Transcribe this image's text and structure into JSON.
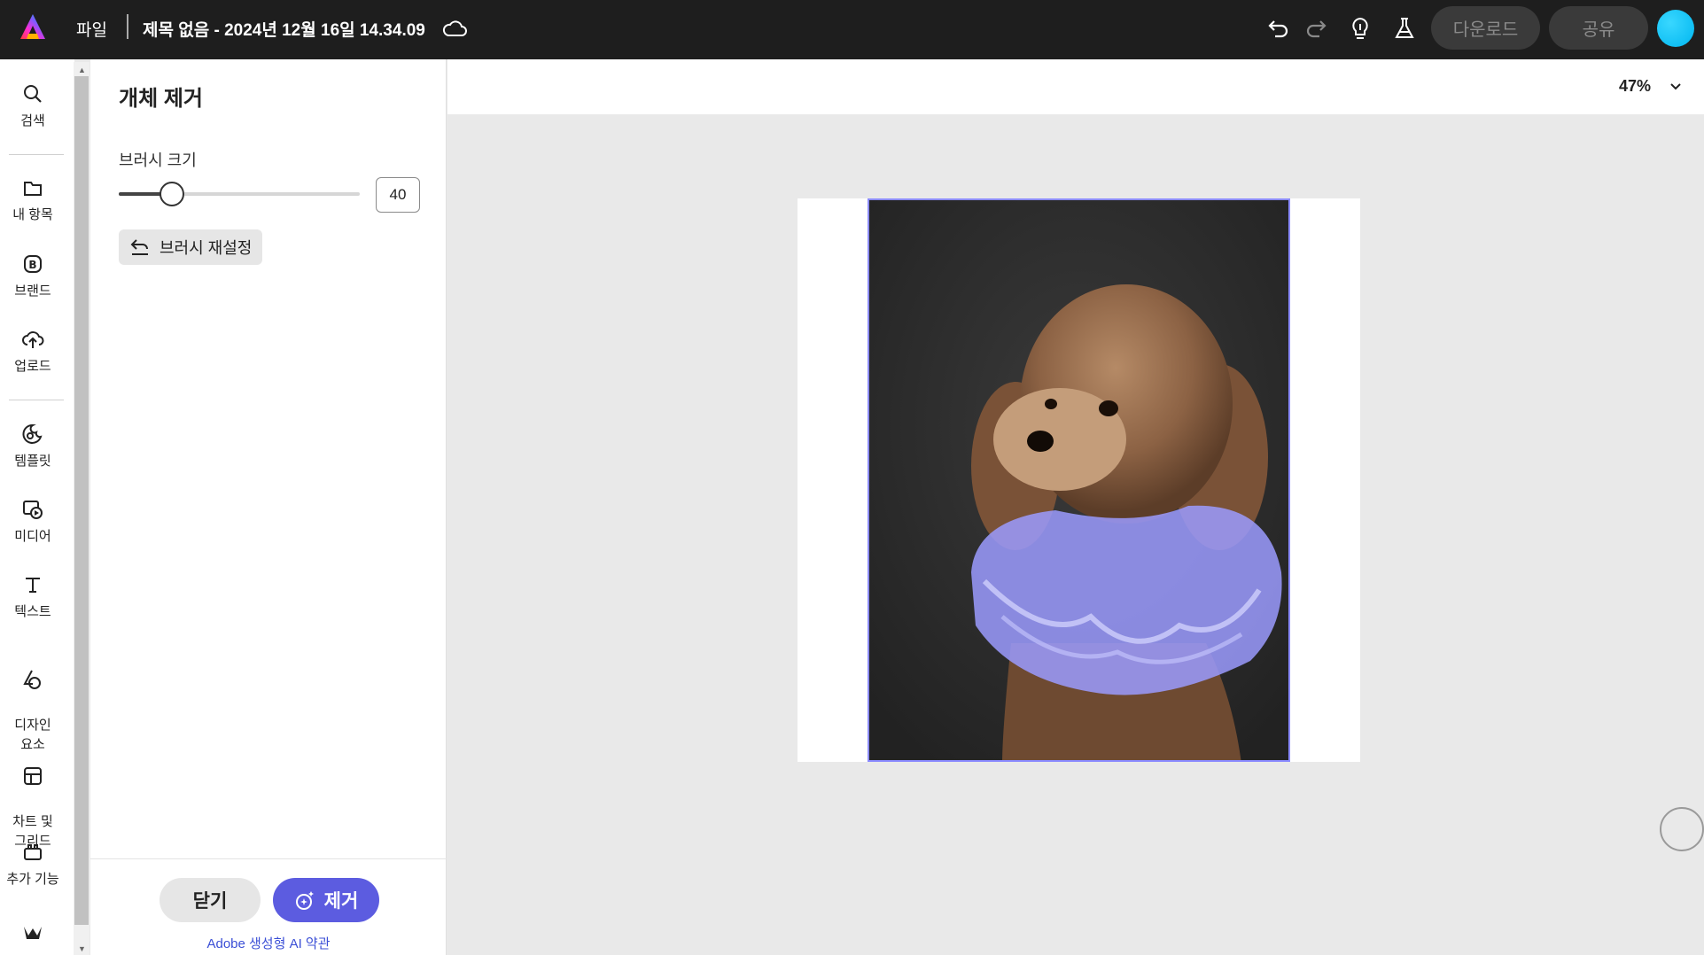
{
  "topbar": {
    "file_menu": "파일",
    "document_title": "제목 없음 - 2024년 12월 16일 14.34.09",
    "download_label": "다운로드",
    "share_label": "공유"
  },
  "rail": {
    "items": [
      {
        "label": "검색",
        "icon": "search-icon"
      },
      {
        "label": "내 항목",
        "icon": "folder-icon"
      },
      {
        "label": "브랜드",
        "icon": "brand-icon"
      },
      {
        "label": "업로드",
        "icon": "upload-icon"
      },
      {
        "label": "템플릿",
        "icon": "template-icon"
      },
      {
        "label": "미디어",
        "icon": "media-icon"
      },
      {
        "label": "텍스트",
        "icon": "text-icon"
      },
      {
        "label": "디자인\n요소",
        "icon": "design-elements-icon"
      },
      {
        "label": "차트 및\n그리드",
        "icon": "chart-grid-icon"
      },
      {
        "label": "추가 기능",
        "icon": "add-ons-icon"
      }
    ]
  },
  "panel": {
    "title": "개체 제거",
    "brush_size_label": "브러시 크기",
    "brush_size_value": "40",
    "brush_size_fraction": 0.22,
    "reset_label": "브러시 재설정",
    "close_label": "닫기",
    "remove_label": "제거",
    "terms_link": "Adobe 생성형 AI 약관"
  },
  "canvas": {
    "zoom": "47%"
  },
  "colors": {
    "accent": "#5c5ce0",
    "selection_overlay": "#8b8bff",
    "topbar_bg": "#1e1e1e"
  }
}
